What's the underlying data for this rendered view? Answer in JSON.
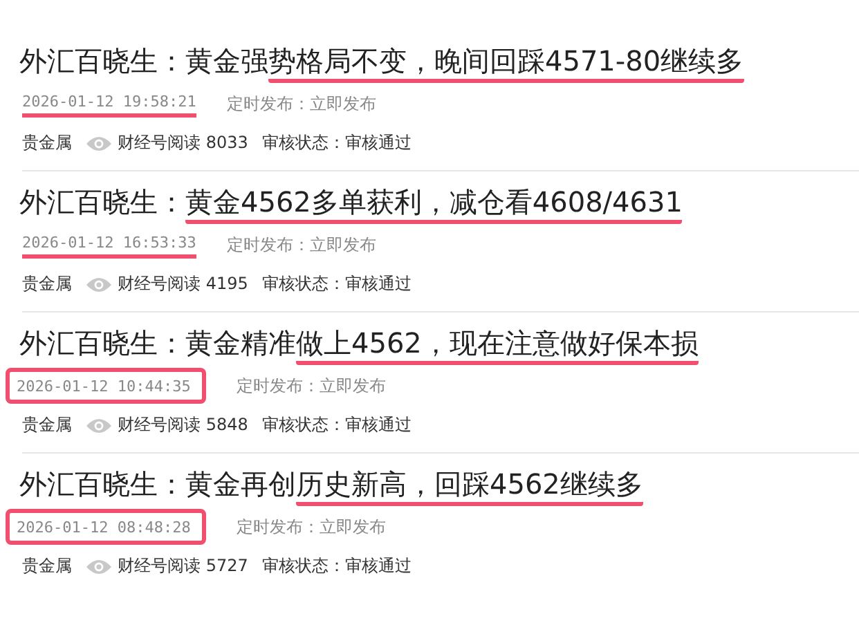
{
  "articles": [
    {
      "title": {
        "plain": "外汇百晓生：黄金强",
        "marked": "势格局不变，晚间回踩4571-80继续多"
      },
      "date": "2026-01-12 19:58:21",
      "date_underlined": true,
      "date_boxed": false,
      "schedule": "定时发布：立即发布",
      "category": "贵金属",
      "reads": "财经号阅读 8033",
      "status": "审核状态：审核通过"
    },
    {
      "title": {
        "plain": "外汇百晓生：",
        "marked": "黄金4562多单获利，减仓看4608/4631"
      },
      "date": "2026-01-12 16:53:33",
      "date_underlined": true,
      "date_boxed": false,
      "schedule": "定时发布：立即发布",
      "category": "贵金属",
      "reads": "财经号阅读 4195",
      "status": "审核状态：审核通过"
    },
    {
      "title": {
        "plain": "外汇百晓生：黄金精准",
        "marked": "做上4562，现在注意做好保本损"
      },
      "date": "2026-01-12 10:44:35",
      "date_underlined": false,
      "date_boxed": true,
      "schedule": "定时发布：立即发布",
      "category": "贵金属",
      "reads": "财经号阅读 5848",
      "status": "审核状态：审核通过"
    },
    {
      "title": {
        "plain": "外汇百晓生：黄金再创",
        "marked": "历史新高，回踩4562继续多"
      },
      "date": "2026-01-12 08:48:28",
      "date_underlined": false,
      "date_boxed": true,
      "schedule": "定时发布：立即发布",
      "category": "贵金属",
      "reads": "财经号阅读 5727",
      "status": "审核状态：审核通过"
    }
  ]
}
